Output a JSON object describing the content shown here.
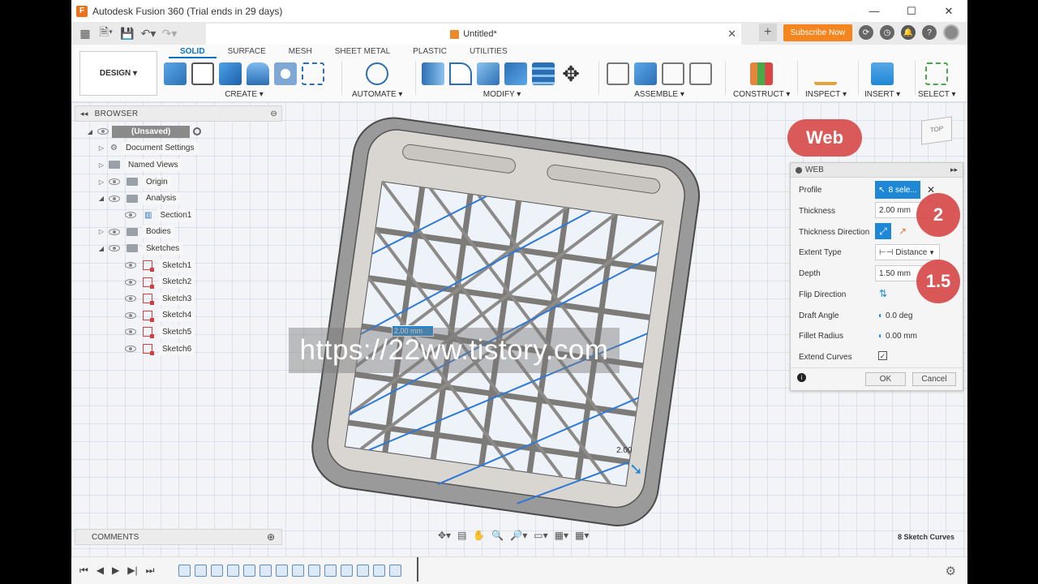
{
  "window": {
    "title": "Autodesk Fusion 360 (Trial ends in 29 days)",
    "min": "—",
    "max": "☐",
    "close": "✕"
  },
  "doc": {
    "title": "Untitled*",
    "close": "✕"
  },
  "qat": {
    "subscribe": "Subscribe Now"
  },
  "ribbon": {
    "workspace": "DESIGN ▾",
    "tabs": [
      "SOLID",
      "SURFACE",
      "MESH",
      "SHEET METAL",
      "PLASTIC",
      "UTILITIES"
    ],
    "groups": [
      "CREATE ▾",
      "AUTOMATE ▾",
      "MODIFY ▾",
      "ASSEMBLE ▾",
      "CONSTRUCT ▾",
      "INSPECT ▾",
      "INSERT ▾",
      "SELECT ▾"
    ]
  },
  "browser": {
    "title": "BROWSER",
    "items": [
      {
        "label": "(Unsaved)"
      },
      {
        "label": "Document Settings"
      },
      {
        "label": "Named Views"
      },
      {
        "label": "Origin"
      },
      {
        "label": "Analysis"
      },
      {
        "label": "Section1"
      },
      {
        "label": "Bodies"
      },
      {
        "label": "Sketches"
      },
      {
        "label": "Sketch1"
      },
      {
        "label": "Sketch2"
      },
      {
        "label": "Sketch3"
      },
      {
        "label": "Sketch4"
      },
      {
        "label": "Sketch5"
      },
      {
        "label": "Sketch6"
      }
    ]
  },
  "comments": {
    "title": "COMMENTS"
  },
  "annotations": {
    "web": "Web",
    "bubble1": "2",
    "bubble2": "1.5",
    "watermark": "https://22ww.tistory.com"
  },
  "canvas": {
    "dim_input": "2.00 mm",
    "dim_label": "2.00",
    "viewcube": "TOP"
  },
  "panel": {
    "title": "WEB",
    "profile_label": "Profile",
    "profile_value": "8 sele...",
    "thickness_label": "Thickness",
    "thickness_value": "2.00 mm",
    "thickness_dir_label": "Thickness Direction",
    "extent_type_label": "Extent Type",
    "extent_type_value": "Distance",
    "depth_label": "Depth",
    "depth_value": "1.50 mm",
    "flip_label": "Flip Direction",
    "draft_label": "Draft Angle",
    "draft_value": "0.0 deg",
    "fillet_label": "Fillet Radius",
    "fillet_value": "0.00 mm",
    "extend_label": "Extend Curves",
    "extend_checked": true,
    "ok": "OK",
    "cancel": "Cancel"
  },
  "status": {
    "selection": "8 Sketch Curves"
  }
}
